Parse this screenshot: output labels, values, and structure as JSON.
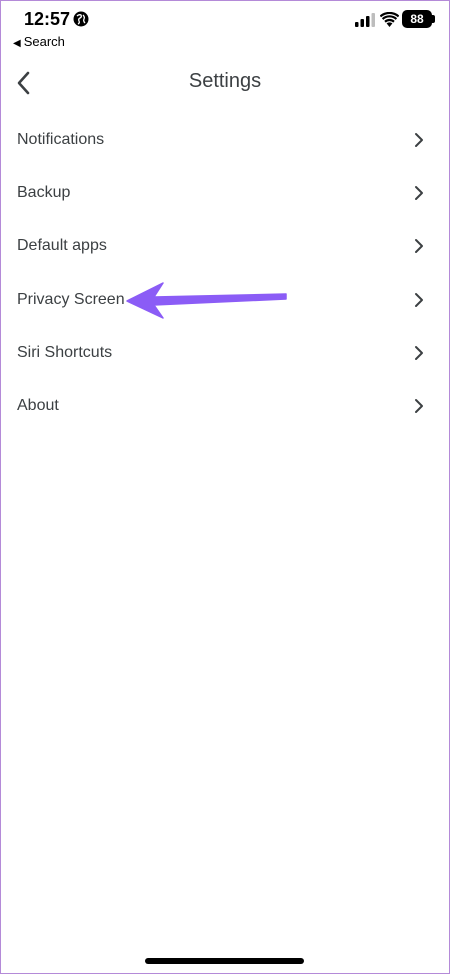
{
  "status_bar": {
    "time": "12:57",
    "back_app_label": "Search",
    "battery_level": "88"
  },
  "header": {
    "title": "Settings"
  },
  "settings": {
    "items": [
      {
        "label": "Notifications"
      },
      {
        "label": "Backup"
      },
      {
        "label": "Default apps"
      },
      {
        "label": "Privacy Screen"
      },
      {
        "label": "Siri Shortcuts"
      },
      {
        "label": "About"
      }
    ]
  },
  "annotation": {
    "arrow_color": "#8b5cf6"
  },
  "icons": [
    "globe-icon",
    "signal-icon",
    "wifi-icon",
    "battery-icon",
    "back-arrow-icon",
    "chevron-right-icon"
  ]
}
